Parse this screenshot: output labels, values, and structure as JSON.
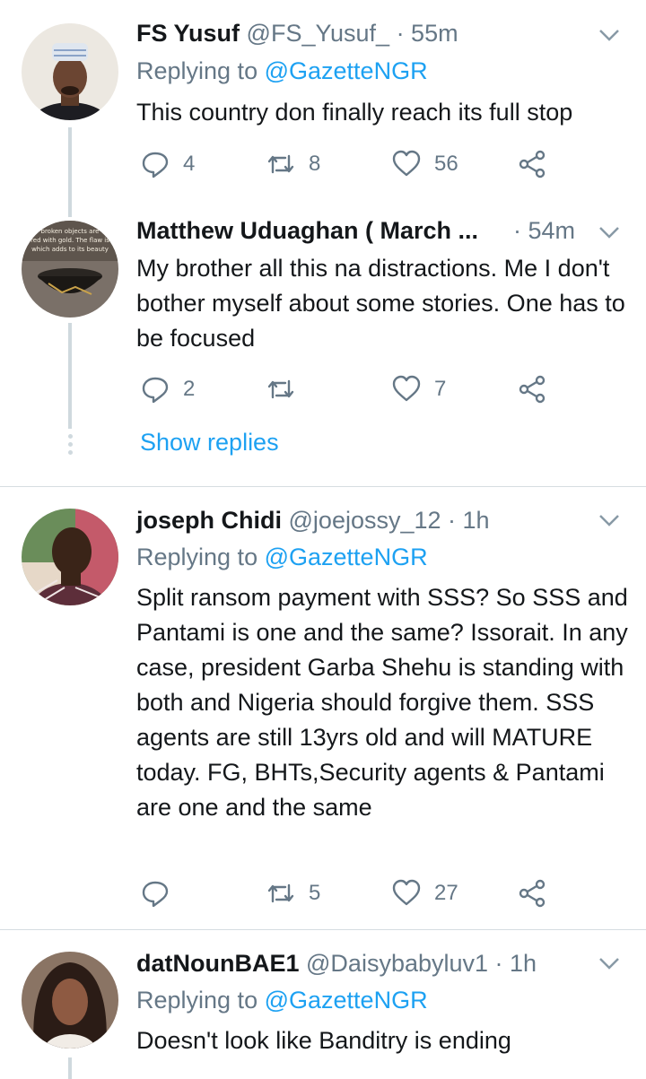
{
  "colors": {
    "accent": "#1da1f2",
    "muted": "#657786",
    "text": "#14171a"
  },
  "tweets": [
    {
      "name": "FS Yusuf",
      "handle": "@FS_Yusuf_",
      "time": "· 55m",
      "replying_prefix": "Replying to",
      "replying_to": "@GazetteNGR",
      "text": "This country don finally reach its full stop",
      "replies": "4",
      "retweets": "8",
      "likes": "56"
    },
    {
      "name": "Matthew Uduaghan ( March ...",
      "handle": "",
      "time": "· 54m",
      "text": "My brother all this na distractions.  Me I don't bother myself about some stories. One has to be focused",
      "replies": "2",
      "retweets": "",
      "likes": "7",
      "show_replies": "Show replies"
    },
    {
      "name": "joseph Chidi",
      "handle": "@joejossy_12",
      "time": "· 1h",
      "replying_prefix": "Replying to",
      "replying_to": "@GazetteNGR",
      "text": "Split ransom payment with SSS? So SSS and Pantami is one and the same? Issorait. In any case, president Garba Shehu is standing with both and Nigeria should forgive them. SSS agents are still 13yrs old and will MATURE today. FG, BHTs,Security agents & Pantami are one and the same",
      "replies": "",
      "retweets": "5",
      "likes": "27"
    },
    {
      "name": "datNounBAE1",
      "handle": "@Daisybabyluv1",
      "time": "· 1h",
      "replying_prefix": "Replying to",
      "replying_to": "@GazetteNGR",
      "text": "Doesn't look like Banditry is ending"
    }
  ]
}
